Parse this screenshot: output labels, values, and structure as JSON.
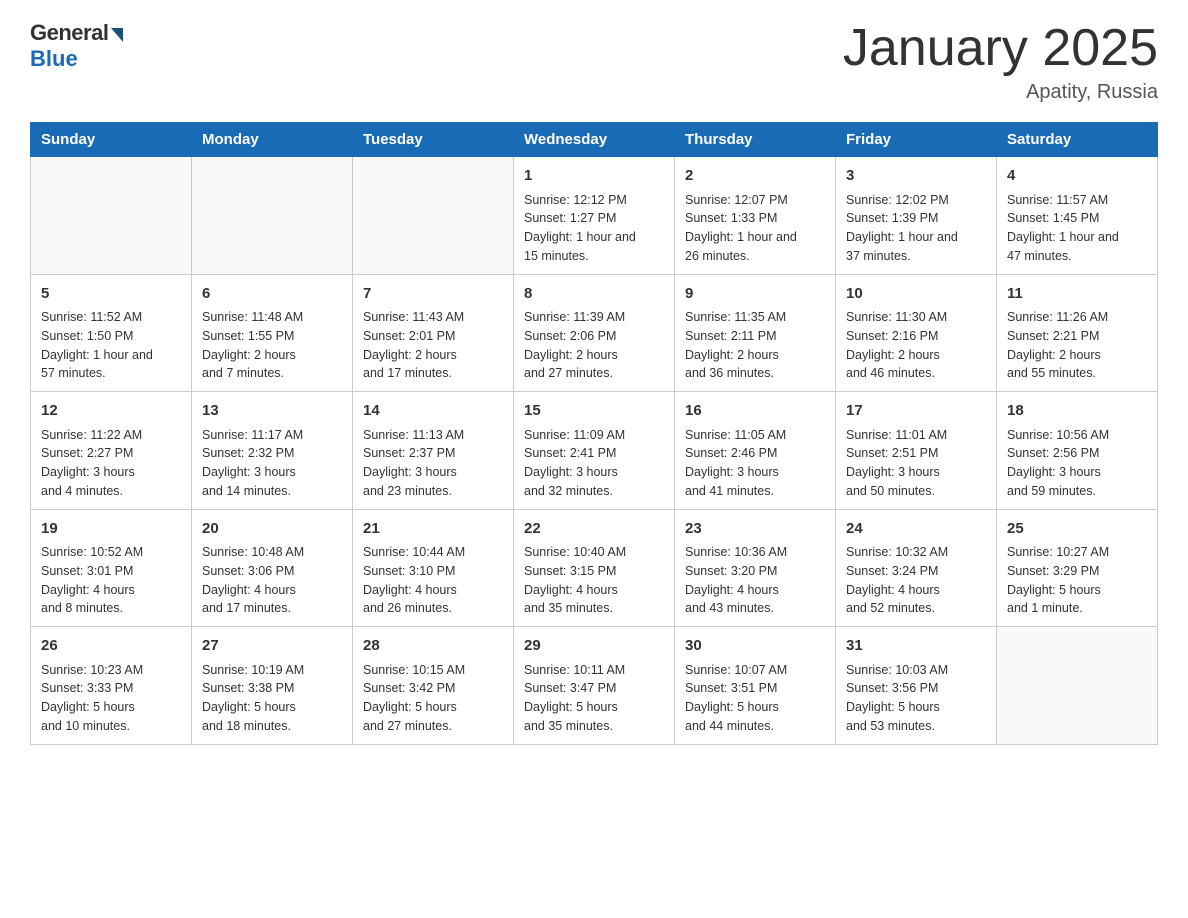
{
  "header": {
    "title": "January 2025",
    "location": "Apatity, Russia",
    "logo_general": "General",
    "logo_blue": "Blue"
  },
  "weekdays": [
    "Sunday",
    "Monday",
    "Tuesday",
    "Wednesday",
    "Thursday",
    "Friday",
    "Saturday"
  ],
  "weeks": [
    [
      {
        "day": "",
        "info": ""
      },
      {
        "day": "",
        "info": ""
      },
      {
        "day": "",
        "info": ""
      },
      {
        "day": "1",
        "info": "Sunrise: 12:12 PM\nSunset: 1:27 PM\nDaylight: 1 hour and\n15 minutes."
      },
      {
        "day": "2",
        "info": "Sunrise: 12:07 PM\nSunset: 1:33 PM\nDaylight: 1 hour and\n26 minutes."
      },
      {
        "day": "3",
        "info": "Sunrise: 12:02 PM\nSunset: 1:39 PM\nDaylight: 1 hour and\n37 minutes."
      },
      {
        "day": "4",
        "info": "Sunrise: 11:57 AM\nSunset: 1:45 PM\nDaylight: 1 hour and\n47 minutes."
      }
    ],
    [
      {
        "day": "5",
        "info": "Sunrise: 11:52 AM\nSunset: 1:50 PM\nDaylight: 1 hour and\n57 minutes."
      },
      {
        "day": "6",
        "info": "Sunrise: 11:48 AM\nSunset: 1:55 PM\nDaylight: 2 hours\nand 7 minutes."
      },
      {
        "day": "7",
        "info": "Sunrise: 11:43 AM\nSunset: 2:01 PM\nDaylight: 2 hours\nand 17 minutes."
      },
      {
        "day": "8",
        "info": "Sunrise: 11:39 AM\nSunset: 2:06 PM\nDaylight: 2 hours\nand 27 minutes."
      },
      {
        "day": "9",
        "info": "Sunrise: 11:35 AM\nSunset: 2:11 PM\nDaylight: 2 hours\nand 36 minutes."
      },
      {
        "day": "10",
        "info": "Sunrise: 11:30 AM\nSunset: 2:16 PM\nDaylight: 2 hours\nand 46 minutes."
      },
      {
        "day": "11",
        "info": "Sunrise: 11:26 AM\nSunset: 2:21 PM\nDaylight: 2 hours\nand 55 minutes."
      }
    ],
    [
      {
        "day": "12",
        "info": "Sunrise: 11:22 AM\nSunset: 2:27 PM\nDaylight: 3 hours\nand 4 minutes."
      },
      {
        "day": "13",
        "info": "Sunrise: 11:17 AM\nSunset: 2:32 PM\nDaylight: 3 hours\nand 14 minutes."
      },
      {
        "day": "14",
        "info": "Sunrise: 11:13 AM\nSunset: 2:37 PM\nDaylight: 3 hours\nand 23 minutes."
      },
      {
        "day": "15",
        "info": "Sunrise: 11:09 AM\nSunset: 2:41 PM\nDaylight: 3 hours\nand 32 minutes."
      },
      {
        "day": "16",
        "info": "Sunrise: 11:05 AM\nSunset: 2:46 PM\nDaylight: 3 hours\nand 41 minutes."
      },
      {
        "day": "17",
        "info": "Sunrise: 11:01 AM\nSunset: 2:51 PM\nDaylight: 3 hours\nand 50 minutes."
      },
      {
        "day": "18",
        "info": "Sunrise: 10:56 AM\nSunset: 2:56 PM\nDaylight: 3 hours\nand 59 minutes."
      }
    ],
    [
      {
        "day": "19",
        "info": "Sunrise: 10:52 AM\nSunset: 3:01 PM\nDaylight: 4 hours\nand 8 minutes."
      },
      {
        "day": "20",
        "info": "Sunrise: 10:48 AM\nSunset: 3:06 PM\nDaylight: 4 hours\nand 17 minutes."
      },
      {
        "day": "21",
        "info": "Sunrise: 10:44 AM\nSunset: 3:10 PM\nDaylight: 4 hours\nand 26 minutes."
      },
      {
        "day": "22",
        "info": "Sunrise: 10:40 AM\nSunset: 3:15 PM\nDaylight: 4 hours\nand 35 minutes."
      },
      {
        "day": "23",
        "info": "Sunrise: 10:36 AM\nSunset: 3:20 PM\nDaylight: 4 hours\nand 43 minutes."
      },
      {
        "day": "24",
        "info": "Sunrise: 10:32 AM\nSunset: 3:24 PM\nDaylight: 4 hours\nand 52 minutes."
      },
      {
        "day": "25",
        "info": "Sunrise: 10:27 AM\nSunset: 3:29 PM\nDaylight: 5 hours\nand 1 minute."
      }
    ],
    [
      {
        "day": "26",
        "info": "Sunrise: 10:23 AM\nSunset: 3:33 PM\nDaylight: 5 hours\nand 10 minutes."
      },
      {
        "day": "27",
        "info": "Sunrise: 10:19 AM\nSunset: 3:38 PM\nDaylight: 5 hours\nand 18 minutes."
      },
      {
        "day": "28",
        "info": "Sunrise: 10:15 AM\nSunset: 3:42 PM\nDaylight: 5 hours\nand 27 minutes."
      },
      {
        "day": "29",
        "info": "Sunrise: 10:11 AM\nSunset: 3:47 PM\nDaylight: 5 hours\nand 35 minutes."
      },
      {
        "day": "30",
        "info": "Sunrise: 10:07 AM\nSunset: 3:51 PM\nDaylight: 5 hours\nand 44 minutes."
      },
      {
        "day": "31",
        "info": "Sunrise: 10:03 AM\nSunset: 3:56 PM\nDaylight: 5 hours\nand 53 minutes."
      },
      {
        "day": "",
        "info": ""
      }
    ]
  ]
}
